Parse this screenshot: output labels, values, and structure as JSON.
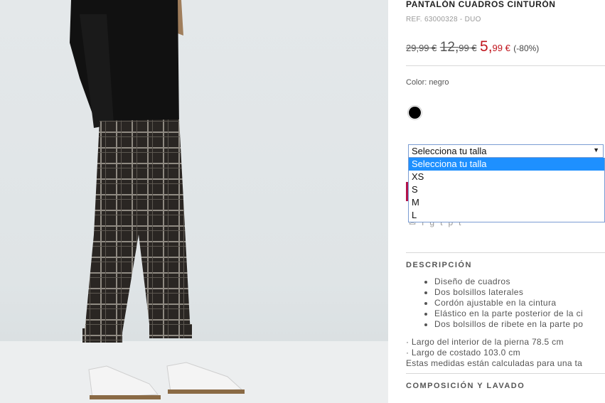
{
  "product": {
    "title": "PANTALÓN CUADROS CINTURÓN",
    "ref": "REF. 63000328 - DUO"
  },
  "price": {
    "original": "29,99 €",
    "previous_int": "12,",
    "previous_dec": "99 €",
    "current_int": "5,",
    "current_dec": "99 €",
    "discount": "(-80%)",
    "sale_color": "#c0141c"
  },
  "color": {
    "label": "Color: negro",
    "swatch": "#000000",
    "swatch_name": "negro"
  },
  "size_select": {
    "selected": "Selecciona tu talla",
    "options": [
      "Selecciona tu talla",
      "XS",
      "S",
      "M",
      "L"
    ],
    "arrow_icon": "chevron-down-icon"
  },
  "social_icons": [
    "mail-icon",
    "facebook-icon",
    "google-plus-icon",
    "twitter-icon",
    "pinterest-icon",
    "tumblr-icon"
  ],
  "description": {
    "heading": "DESCRIPCIÓN",
    "bullets": [
      "Diseño de cuadros",
      "Dos bolsillos laterales",
      "Cordón ajustable en la cintura",
      "Elástico en la parte posterior de la ci",
      "Dos bolsillos de ribete en la parte po"
    ],
    "measures": [
      "· Largo del interior de la pierna 78.5 cm",
      "· Largo de costado 103.0 cm",
      "Estas medidas están calculadas para una ta"
    ]
  },
  "composition": {
    "heading": "COMPOSICIÓN Y LAVADO"
  }
}
